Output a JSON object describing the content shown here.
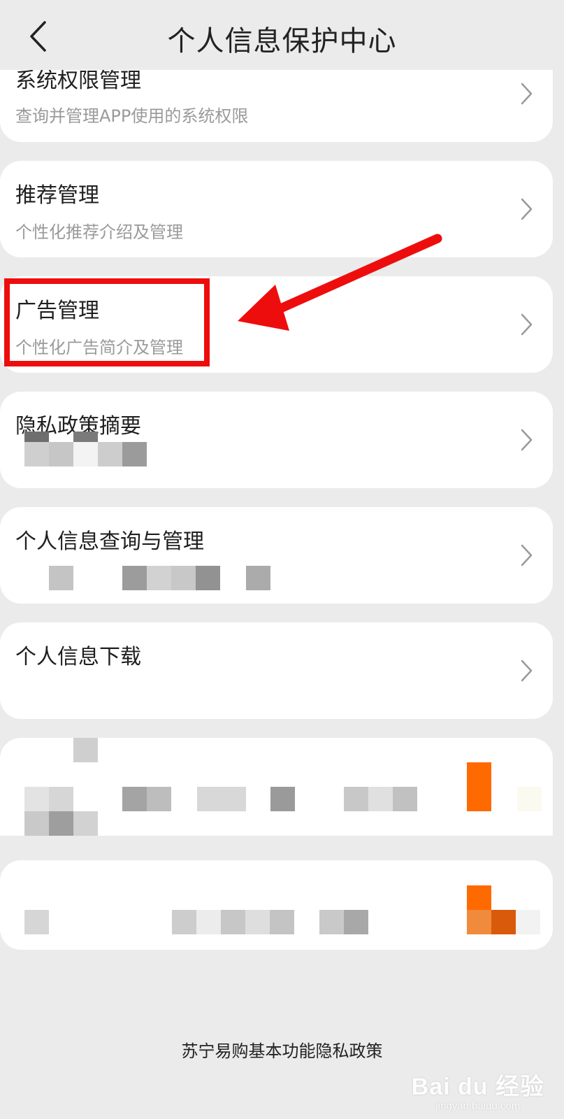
{
  "header": {
    "title": "个人信息保护中心",
    "back_icon": "chevron-left-icon"
  },
  "cards": [
    {
      "title": "系统权限管理",
      "subtitle": "查询并管理APP使用的系统权限"
    },
    {
      "title": "推荐管理",
      "subtitle": "个性化推荐介绍及管理"
    },
    {
      "title": "广告管理",
      "subtitle": "个性化广告简介及管理"
    },
    {
      "title": "隐私政策摘要",
      "subtitle": ""
    },
    {
      "title": "个人信息查询与管理",
      "subtitle": ""
    },
    {
      "title": "个人信息下载",
      "subtitle": ""
    },
    {
      "title": "",
      "subtitle": ""
    },
    {
      "title": "",
      "subtitle": ""
    }
  ],
  "footer": {
    "link": "苏宁易购基本功能隐私政策"
  },
  "watermark": {
    "main": "Bai du 经验",
    "sub": "jingyan.baidu.com"
  },
  "colors": {
    "annotation_red": "#ee0d0d",
    "brand_orange": "#ff6a00",
    "background": "#ebebeb"
  }
}
